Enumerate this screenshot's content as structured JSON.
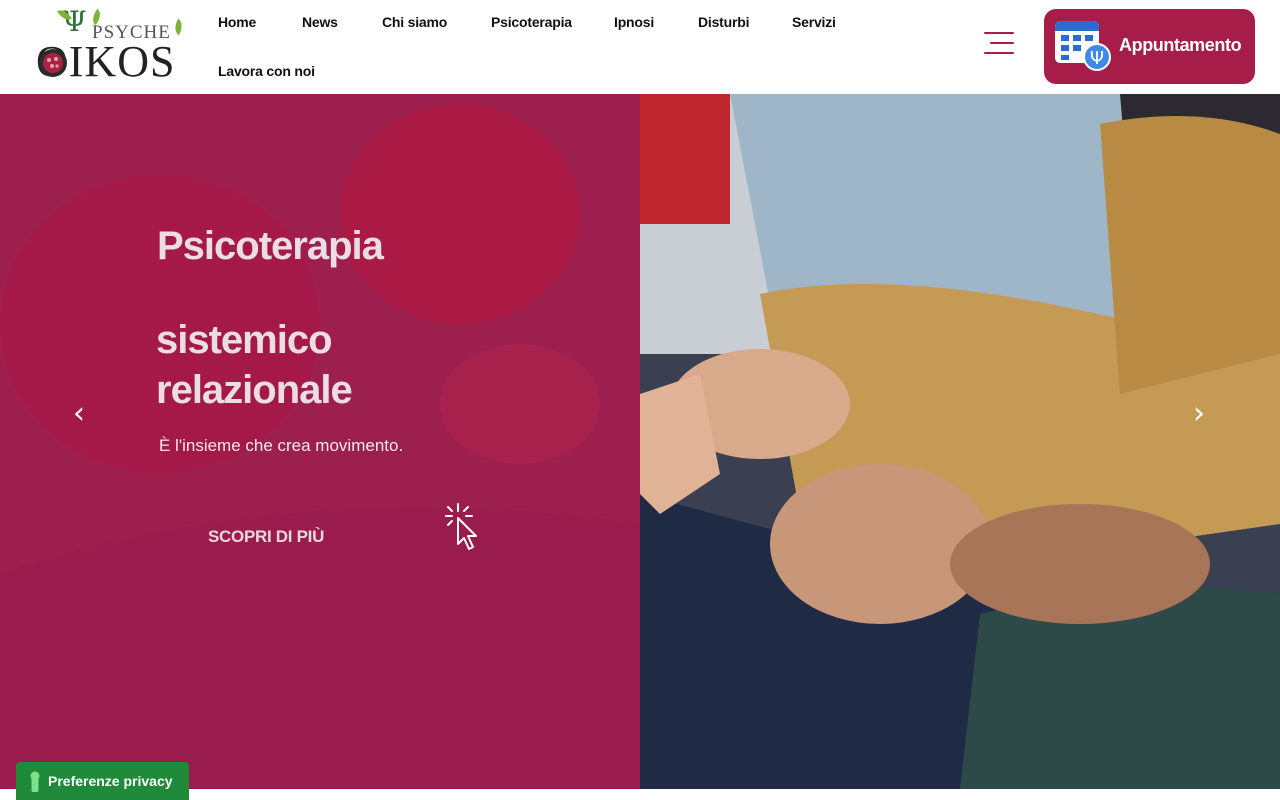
{
  "logo": {
    "top_text": "PSYCHE",
    "main_text": "OIKOS"
  },
  "nav": {
    "items": [
      {
        "label": "Home"
      },
      {
        "label": "News"
      },
      {
        "label": "Chi siamo"
      },
      {
        "label": "Psicoterapia"
      },
      {
        "label": "Ipnosi"
      },
      {
        "label": "Disturbi"
      },
      {
        "label": "Servizi"
      },
      {
        "label": "Lavora con noi"
      }
    ]
  },
  "header": {
    "menu_icon": "hamburger-menu-icon",
    "appointment_label": "Appuntamento",
    "appointment_icon": "calendar-psi-icon"
  },
  "hero": {
    "title": "Psicoterapia",
    "subtitle_line1": "sistemico",
    "subtitle_line2": "relazionale",
    "tagline": "È l'insieme che crea movimento.",
    "cta_label": "SCOPRI DI PIÙ",
    "cta_icon": "click-cursor-icon",
    "prev_arrow": "‹",
    "next_arrow": "›"
  },
  "privacy": {
    "label": "Preferenze privacy",
    "icon": "keyhole-icon"
  },
  "colors": {
    "brand": "#a61d4a",
    "privacy_green": "#1e8a3a"
  }
}
